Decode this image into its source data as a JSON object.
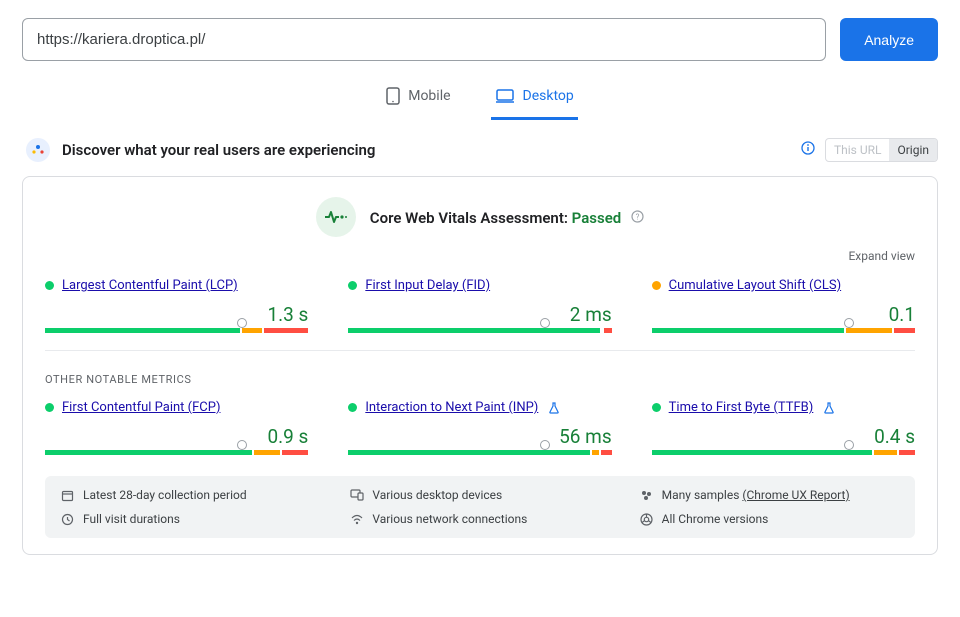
{
  "search": {
    "value": "https://kariera.droptica.pl/",
    "analyze_label": "Analyze"
  },
  "tabs": {
    "mobile": "Mobile",
    "desktop": "Desktop",
    "active": "desktop"
  },
  "section": {
    "title": "Discover what your real users are experiencing",
    "seg_url": "This URL",
    "seg_origin": "Origin"
  },
  "assessment": {
    "label": "Core Web Vitals Assessment: ",
    "status": "Passed",
    "expand": "Expand view"
  },
  "metrics_main": [
    {
      "name": "Largest Contentful Paint (LCP)",
      "value": "1.3 s",
      "status": "green",
      "bar": {
        "g": 75,
        "o": 8,
        "r": 17
      },
      "marker": 74
    },
    {
      "name": "First Input Delay (FID)",
      "value": "2 ms",
      "status": "green",
      "bar": {
        "g": 97,
        "o": 0,
        "r": 3
      },
      "marker": 74
    },
    {
      "name": "Cumulative Layout Shift (CLS)",
      "value": "0.1",
      "status": "orange",
      "bar": {
        "g": 74,
        "o": 18,
        "r": 8
      },
      "marker": 74
    }
  ],
  "other_label": "OTHER NOTABLE METRICS",
  "metrics_other": [
    {
      "name": "First Contentful Paint (FCP)",
      "value": "0.9 s",
      "status": "green",
      "bar": {
        "g": 80,
        "o": 10,
        "r": 10
      },
      "marker": 74,
      "exp": false
    },
    {
      "name": "Interaction to Next Paint (INP)",
      "value": "56 ms",
      "status": "green",
      "bar": {
        "g": 93,
        "o": 3,
        "r": 4
      },
      "marker": 74,
      "exp": true
    },
    {
      "name": "Time to First Byte (TTFB)",
      "value": "0.4 s",
      "status": "green",
      "bar": {
        "g": 85,
        "o": 9,
        "r": 6
      },
      "marker": 74,
      "exp": true
    }
  ],
  "footer": {
    "period": "Latest 28-day collection period",
    "devices": "Various desktop devices",
    "samples_prefix": "Many samples ",
    "samples_link": "(Chrome UX Report)",
    "durations": "Full visit durations",
    "network": "Various network connections",
    "chrome": "All Chrome versions"
  }
}
